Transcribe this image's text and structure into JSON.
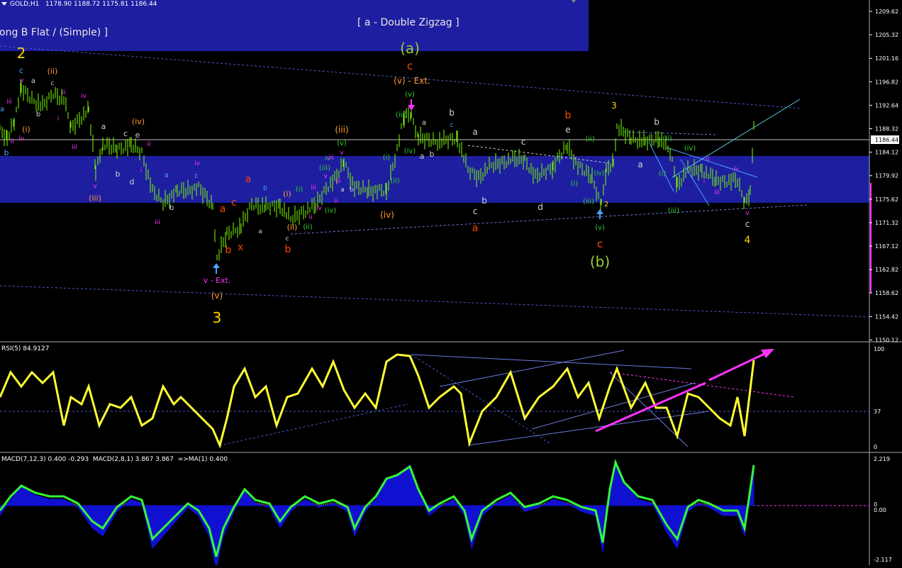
{
  "symbol_header": "GOLD,H1   1178.90 1188.72 1175.81 1186.44",
  "chart_data": [
    {
      "type": "line",
      "title": "GOLD,H1",
      "ohlc_last": {
        "open": 1178.9,
        "high": 1188.72,
        "low": 1175.81,
        "close": 1186.44
      },
      "current_price_label": "1186.44",
      "ylim": [
        1148.6,
        1211.0
      ],
      "yticks": [
        "1209.62",
        "1205.32",
        "1201.16",
        "1196.82",
        "1192.64",
        "1188.32",
        "1184.12",
        "1179.92",
        "1175.62",
        "1171.32",
        "1167.12",
        "1162.82",
        "1158.62",
        "1154.42",
        "1150.12"
      ],
      "annotations": {
        "top_left_box": "ong B Flat / (Simple) ]",
        "top_right_box": "[ a - Double Zigzag ]"
      },
      "wave_labels": [
        {
          "t": "2",
          "c": "#ffd700",
          "s": 20,
          "x": 30,
          "y": 82
        },
        {
          "t": "c",
          "c": "#4aa3ff",
          "s": 11,
          "x": 30,
          "y": 103
        },
        {
          "t": "v",
          "c": "#ff33ff",
          "s": 9,
          "x": 31,
          "y": 116
        },
        {
          "t": "(ii)",
          "c": "#ff9933",
          "s": 11,
          "x": 74,
          "y": 104
        },
        {
          "t": "c",
          "c": "#d0d0d0",
          "s": 9,
          "x": 74,
          "y": 120
        },
        {
          "t": "a",
          "c": "#d0d0d0",
          "s": 10,
          "x": 47,
          "y": 117
        },
        {
          "t": "ii",
          "c": "#ff33ff",
          "s": 9,
          "x": 90,
          "y": 133
        },
        {
          "t": "iii",
          "c": "#ff33ff",
          "s": 9,
          "x": 13,
          "y": 146
        },
        {
          "t": "ii",
          "c": "#ff33ff",
          "s": 9,
          "x": 17,
          "y": 202
        },
        {
          "t": "iv",
          "c": "#ff33ff",
          "s": 9,
          "x": 30,
          "y": 198
        },
        {
          "t": "b",
          "c": "#d0d0d0",
          "s": 10,
          "x": 54,
          "y": 164
        },
        {
          "t": "(i)",
          "c": "#ff9933",
          "s": 11,
          "x": 37,
          "y": 186
        },
        {
          "t": "iv",
          "c": "#ff33ff",
          "s": 9,
          "x": 118,
          "y": 138
        },
        {
          "t": "i",
          "c": "#ff33ff",
          "s": 9,
          "x": 82,
          "y": 170
        },
        {
          "t": "iii",
          "c": "#ff33ff",
          "s": 9,
          "x": 105,
          "y": 210
        },
        {
          "t": "a",
          "c": "#4aa3ff",
          "s": 10,
          "x": 3,
          "y": 157
        },
        {
          "t": "b",
          "c": "#4aa3ff",
          "s": 11,
          "x": 9,
          "y": 219
        },
        {
          "t": "a",
          "c": "#d0d0d0",
          "s": 11,
          "x": 146,
          "y": 182
        },
        {
          "t": "c",
          "c": "#d0d0d0",
          "s": 11,
          "x": 177,
          "y": 192
        },
        {
          "t": "e",
          "c": "#d0d0d0",
          "s": 11,
          "x": 194,
          "y": 194
        },
        {
          "t": "(iv)",
          "c": "#ff9933",
          "s": 11,
          "x": 195,
          "y": 175
        },
        {
          "t": "ii",
          "c": "#ff33ff",
          "s": 9,
          "x": 210,
          "y": 206
        },
        {
          "t": "b",
          "c": "#d0d0d0",
          "s": 11,
          "x": 166,
          "y": 249
        },
        {
          "t": "i",
          "c": "#ff33ff",
          "s": 9,
          "x": 199,
          "y": 243
        },
        {
          "t": "d",
          "c": "#d0d0d0",
          "s": 11,
          "x": 186,
          "y": 260
        },
        {
          "t": "v",
          "c": "#ff33ff",
          "s": 9,
          "x": 134,
          "y": 265
        },
        {
          "t": "(iii)",
          "c": "#ff9933",
          "s": 11,
          "x": 134,
          "y": 283
        },
        {
          "t": "a",
          "c": "#4aa3ff",
          "s": 10,
          "x": 235,
          "y": 250
        },
        {
          "t": "iv",
          "c": "#ff33ff",
          "s": 9,
          "x": 278,
          "y": 233
        },
        {
          "t": "c",
          "c": "#4aa3ff",
          "s": 10,
          "x": 277,
          "y": 251
        },
        {
          "t": "b",
          "c": "#d0d0d0",
          "s": 10,
          "x": 242,
          "y": 296
        },
        {
          "t": "iii",
          "c": "#ff33ff",
          "s": 9,
          "x": 222,
          "y": 316
        },
        {
          "t": "a",
          "c": "#ff4400",
          "s": 14,
          "x": 314,
          "y": 299
        },
        {
          "t": "c",
          "c": "#ff4400",
          "s": 14,
          "x": 330,
          "y": 290
        },
        {
          "t": "a",
          "c": "#ff4400",
          "s": 14,
          "x": 350,
          "y": 257
        },
        {
          "t": "b",
          "c": "#4aa3ff",
          "s": 9,
          "x": 374,
          "y": 268
        },
        {
          "t": "a",
          "c": "#d0d0d0",
          "s": 9,
          "x": 367,
          "y": 329
        },
        {
          "t": "b",
          "c": "#ff4400",
          "s": 14,
          "x": 322,
          "y": 357
        },
        {
          "t": "x",
          "c": "#ff4400",
          "s": 14,
          "x": 339,
          "y": 353
        },
        {
          "t": "(i)",
          "c": "#ff9933",
          "s": 11,
          "x": 405,
          "y": 277
        },
        {
          "t": "(i)",
          "c": "#33cc33",
          "s": 10,
          "x": 422,
          "y": 270
        },
        {
          "t": "ii",
          "c": "#ff33ff",
          "s": 9,
          "x": 438,
          "y": 309
        },
        {
          "t": "iii",
          "c": "#ff33ff",
          "s": 9,
          "x": 442,
          "y": 267
        },
        {
          "t": "iv",
          "c": "#ff33ff",
          "s": 9,
          "x": 450,
          "y": 296
        },
        {
          "t": "(ii)",
          "c": "#ff9933",
          "s": 11,
          "x": 412,
          "y": 324
        },
        {
          "t": "c",
          "c": "#d0d0d0",
          "s": 9,
          "x": 405,
          "y": 339
        },
        {
          "t": "(ii)",
          "c": "#33cc33",
          "s": 10,
          "x": 434,
          "y": 323
        },
        {
          "t": "b",
          "c": "#ff4400",
          "s": 14,
          "x": 406,
          "y": 356
        },
        {
          "t": "v",
          "c": "#ff33ff",
          "s": 9,
          "x": 459,
          "y": 251
        },
        {
          "t": "(iii)",
          "c": "#33cc33",
          "s": 10,
          "x": 458,
          "y": 240
        },
        {
          "t": "iv",
          "c": "#33cc33",
          "s": 9,
          "x": 462,
          "y": 226
        },
        {
          "t": "iii",
          "c": "#ff33ff",
          "s": 9,
          "x": 467,
          "y": 225
        },
        {
          "t": "iv",
          "c": "#ff33ff",
          "s": 9,
          "x": 477,
          "y": 258
        },
        {
          "t": "a",
          "c": "#d0d0d0",
          "s": 9,
          "x": 483,
          "y": 270
        },
        {
          "t": "b",
          "c": "#d0d0d0",
          "s": 9,
          "x": 496,
          "y": 270
        },
        {
          "t": "ii",
          "c": "#ff33ff",
          "s": 9,
          "x": 474,
          "y": 286
        },
        {
          "t": "(iv)",
          "c": "#33cc33",
          "s": 10,
          "x": 466,
          "y": 300
        },
        {
          "t": "(iii)",
          "c": "#ff9933",
          "s": 12,
          "x": 482,
          "y": 187
        },
        {
          "t": "(v)",
          "c": "#33cc33",
          "s": 10,
          "x": 482,
          "y": 205
        },
        {
          "t": "v",
          "c": "#ff33ff",
          "s": 9,
          "x": 482,
          "y": 218
        },
        {
          "t": "(i)",
          "c": "#33cc33",
          "s": 10,
          "x": 545,
          "y": 225
        },
        {
          "t": "(ii)",
          "c": "#33cc33",
          "s": 10,
          "x": 557,
          "y": 258
        },
        {
          "t": "(iv)",
          "c": "#ff9933",
          "s": 12,
          "x": 546,
          "y": 307
        },
        {
          "t": "(iii)",
          "c": "#33cc33",
          "s": 10,
          "x": 566,
          "y": 165
        },
        {
          "t": "(iv)",
          "c": "#33cc33",
          "s": 10,
          "x": 578,
          "y": 216
        },
        {
          "t": "(v)",
          "c": "#33cc33",
          "s": 10,
          "x": 578,
          "y": 136
        },
        {
          "t": "(a)",
          "c": "#9acd32",
          "s": 20,
          "x": 578,
          "y": 75
        },
        {
          "t": "c",
          "c": "#ff4400",
          "s": 15,
          "x": 578,
          "y": 98
        },
        {
          "t": "(v) - Ext.",
          "c": "#ff9933",
          "s": 12,
          "x": 581,
          "y": 118
        },
        {
          "t": "a",
          "c": "#d0d0d0",
          "s": 10,
          "x": 598,
          "y": 176
        },
        {
          "t": "a",
          "c": "#d0d0d0",
          "s": 11,
          "x": 595,
          "y": 224
        },
        {
          "t": "b",
          "c": "#d0d0d0",
          "s": 11,
          "x": 609,
          "y": 221
        },
        {
          "t": "b",
          "c": "#d0d0d0",
          "s": 12,
          "x": 637,
          "y": 163
        },
        {
          "t": "c",
          "c": "#4aa3ff",
          "s": 9,
          "x": 637,
          "y": 179
        },
        {
          "t": "a",
          "c": "#d0d0d0",
          "s": 12,
          "x": 670,
          "y": 190
        },
        {
          "t": "c",
          "c": "#d0d0d0",
          "s": 12,
          "x": 738,
          "y": 204
        },
        {
          "t": "e",
          "c": "#d0d0d0",
          "s": 12,
          "x": 801,
          "y": 187
        },
        {
          "t": "b",
          "c": "#ff4400",
          "s": 14,
          "x": 801,
          "y": 167
        },
        {
          "t": "c",
          "c": "#d0d0d0",
          "s": 12,
          "x": 670,
          "y": 302
        },
        {
          "t": "b",
          "c": "#d0d0d0",
          "s": 12,
          "x": 683,
          "y": 287
        },
        {
          "t": "d",
          "c": "#d0d0d0",
          "s": 12,
          "x": 762,
          "y": 296
        },
        {
          "t": "a",
          "c": "#ff4400",
          "s": 14,
          "x": 670,
          "y": 326
        },
        {
          "t": "(ii)",
          "c": "#33cc33",
          "s": 10,
          "x": 832,
          "y": 199
        },
        {
          "t": "(i)",
          "c": "#33cc33",
          "s": 10,
          "x": 810,
          "y": 262
        },
        {
          "t": "(iv)",
          "c": "#33cc33",
          "s": 9,
          "x": 845,
          "y": 247
        },
        {
          "t": "(iii)",
          "c": "#33cc33",
          "s": 10,
          "x": 830,
          "y": 287
        },
        {
          "t": "2",
          "c": "#ffd700",
          "s": 10,
          "x": 855,
          "y": 291
        },
        {
          "t": "(v)",
          "c": "#33cc33",
          "s": 10,
          "x": 846,
          "y": 324
        },
        {
          "t": "c",
          "c": "#ff4400",
          "s": 15,
          "x": 846,
          "y": 349
        },
        {
          "t": "(b)",
          "c": "#9acd32",
          "s": 20,
          "x": 846,
          "y": 376
        },
        {
          "t": "3",
          "c": "#ffd700",
          "s": 12,
          "x": 866,
          "y": 153
        },
        {
          "t": "b",
          "c": "#d0d0d0",
          "s": 12,
          "x": 926,
          "y": 176
        },
        {
          "t": "a",
          "c": "#d0d0d0",
          "s": 12,
          "x": 903,
          "y": 236
        },
        {
          "t": "(ii)",
          "c": "#33cc33",
          "s": 10,
          "x": 941,
          "y": 198
        },
        {
          "t": "(i)",
          "c": "#33cc33",
          "s": 10,
          "x": 934,
          "y": 248
        },
        {
          "t": "(iv)",
          "c": "#33cc33",
          "s": 10,
          "x": 973,
          "y": 212
        },
        {
          "t": "(iii)",
          "c": "#33cc33",
          "s": 10,
          "x": 950,
          "y": 300
        },
        {
          "t": "i",
          "c": "#ff33ff",
          "s": 9,
          "x": 993,
          "y": 258
        },
        {
          "t": "ii",
          "c": "#ff33ff",
          "s": 9,
          "x": 998,
          "y": 227
        },
        {
          "t": "iii",
          "c": "#ff33ff",
          "s": 9,
          "x": 1011,
          "y": 274
        },
        {
          "t": "iv",
          "c": "#ff33ff",
          "s": 9,
          "x": 1038,
          "y": 241
        },
        {
          "t": "v",
          "c": "#ff33ff",
          "s": 9,
          "x": 1054,
          "y": 303
        },
        {
          "t": "c",
          "c": "#d0d0d0",
          "s": 12,
          "x": 1054,
          "y": 320
        },
        {
          "t": "4",
          "c": "#ffd700",
          "s": 14,
          "x": 1054,
          "y": 343
        },
        {
          "t": "v - Ext.",
          "c": "#ff33ff",
          "s": 11,
          "x": 306,
          "y": 399
        },
        {
          "t": "(v)",
          "c": "#ff9933",
          "s": 12,
          "x": 306,
          "y": 421
        },
        {
          "t": "3",
          "c": "#ffd700",
          "s": 20,
          "x": 306,
          "y": 455
        }
      ]
    },
    {
      "type": "line",
      "title": "RSI(5) 84.9127",
      "ylim": [
        0,
        100
      ],
      "yticks": [
        "100",
        "37",
        "0"
      ],
      "level": 37
    },
    {
      "type": "area",
      "title": "MACD(7,12,3) 0.400 -0.293  MACD(2,8,1) 3.867 3.867  =>MA(1) 0.400",
      "ylim": [
        -2.117,
        2.219
      ],
      "yticks": [
        "2.219",
        "0",
        "0.00",
        "-2.117"
      ]
    }
  ]
}
